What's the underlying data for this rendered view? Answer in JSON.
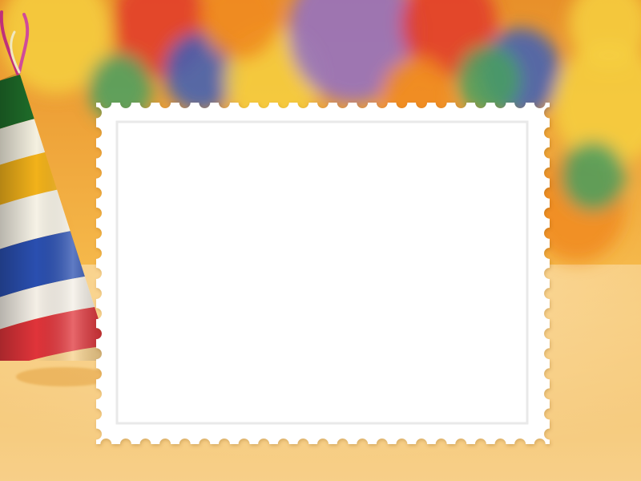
{
  "scene": {
    "background_gradient": [
      "#e8902a",
      "#f5b84a",
      "#f8d79a"
    ],
    "table_color": "#f6c87a",
    "balloon_colors": [
      "#f6d040",
      "#e23a2a",
      "#3c5fb8",
      "#48a060",
      "#f08a20",
      "#9070c8"
    ],
    "party_hat_stripes": [
      "#1f6e2a",
      "#f4f0e0",
      "#f2b21a",
      "#f6f2e6",
      "#2a4fb0",
      "#f4efe6",
      "#e0343a"
    ],
    "stamp_color": "#ffffff",
    "stamp_edge_color": "#e9e9e9"
  }
}
